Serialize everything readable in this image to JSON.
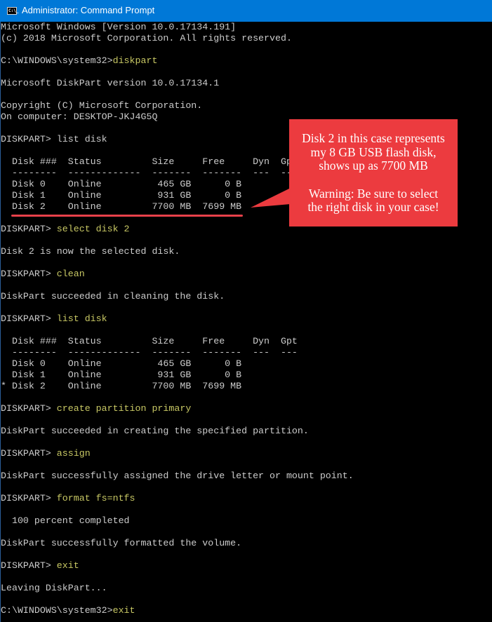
{
  "window": {
    "title": "Administrator: Command Prompt",
    "icon": "cmd-icon",
    "icon_label": "C:\\_"
  },
  "console": {
    "lines": [
      {
        "text": "Microsoft Windows [Version 10.0.17134.191]"
      },
      {
        "text": "(c) 2018 Microsoft Corporation. All rights reserved."
      },
      {
        "text": ""
      },
      {
        "prompt": "C:\\WINDOWS\\system32>",
        "command": "diskpart"
      },
      {
        "text": ""
      },
      {
        "text": "Microsoft DiskPart version 10.0.17134.1"
      },
      {
        "text": ""
      },
      {
        "text": "Copyright (C) Microsoft Corporation."
      },
      {
        "text": "On computer: DESKTOP-JKJ4G5Q"
      },
      {
        "text": ""
      },
      {
        "text": "DISKPART> list disk"
      },
      {
        "text": ""
      },
      {
        "text": "  Disk ###  Status         Size     Free     Dyn  Gpt"
      },
      {
        "text": "  --------  -------------  -------  -------  ---  ---"
      },
      {
        "text": "  Disk 0    Online          465 GB      0 B"
      },
      {
        "text": "  Disk 1    Online          931 GB      0 B"
      },
      {
        "text": "  Disk 2    Online         7700 MB  7699 MB"
      },
      {
        "text": ""
      },
      {
        "prompt": "DISKPART> ",
        "command": "select disk 2"
      },
      {
        "text": ""
      },
      {
        "text": "Disk 2 is now the selected disk."
      },
      {
        "text": ""
      },
      {
        "prompt": "DISKPART> ",
        "command": "clean"
      },
      {
        "text": ""
      },
      {
        "text": "DiskPart succeeded in cleaning the disk."
      },
      {
        "text": ""
      },
      {
        "prompt": "DISKPART> ",
        "command": "list disk"
      },
      {
        "text": ""
      },
      {
        "text": "  Disk ###  Status         Size     Free     Dyn  Gpt"
      },
      {
        "text": "  --------  -------------  -------  -------  ---  ---"
      },
      {
        "text": "  Disk 0    Online          465 GB      0 B"
      },
      {
        "text": "  Disk 1    Online          931 GB      0 B"
      },
      {
        "text": "* Disk 2    Online         7700 MB  7699 MB"
      },
      {
        "text": ""
      },
      {
        "prompt": "DISKPART> ",
        "command": "create partition primary"
      },
      {
        "text": ""
      },
      {
        "text": "DiskPart succeeded in creating the specified partition."
      },
      {
        "text": ""
      },
      {
        "prompt": "DISKPART> ",
        "command": "assign"
      },
      {
        "text": ""
      },
      {
        "text": "DiskPart successfully assigned the drive letter or mount point."
      },
      {
        "text": ""
      },
      {
        "prompt": "DISKPART> ",
        "command": "format fs=ntfs"
      },
      {
        "text": ""
      },
      {
        "text": "  100 percent completed"
      },
      {
        "text": ""
      },
      {
        "text": "DiskPart successfully formatted the volume."
      },
      {
        "text": ""
      },
      {
        "prompt": "DISKPART> ",
        "command": "exit"
      },
      {
        "text": ""
      },
      {
        "text": "Leaving DiskPart..."
      },
      {
        "text": ""
      },
      {
        "prompt": "C:\\WINDOWS\\system32>",
        "command": "exit"
      }
    ]
  },
  "annotation": {
    "lines_1": [
      "Disk 2 in this case represents",
      "my 8 GB USB flash disk,",
      "shows up as 7700 MB"
    ],
    "lines_2": [
      "Warning: Be sure to select",
      "the right disk in your case!"
    ],
    "color": "#ec3b3f"
  }
}
